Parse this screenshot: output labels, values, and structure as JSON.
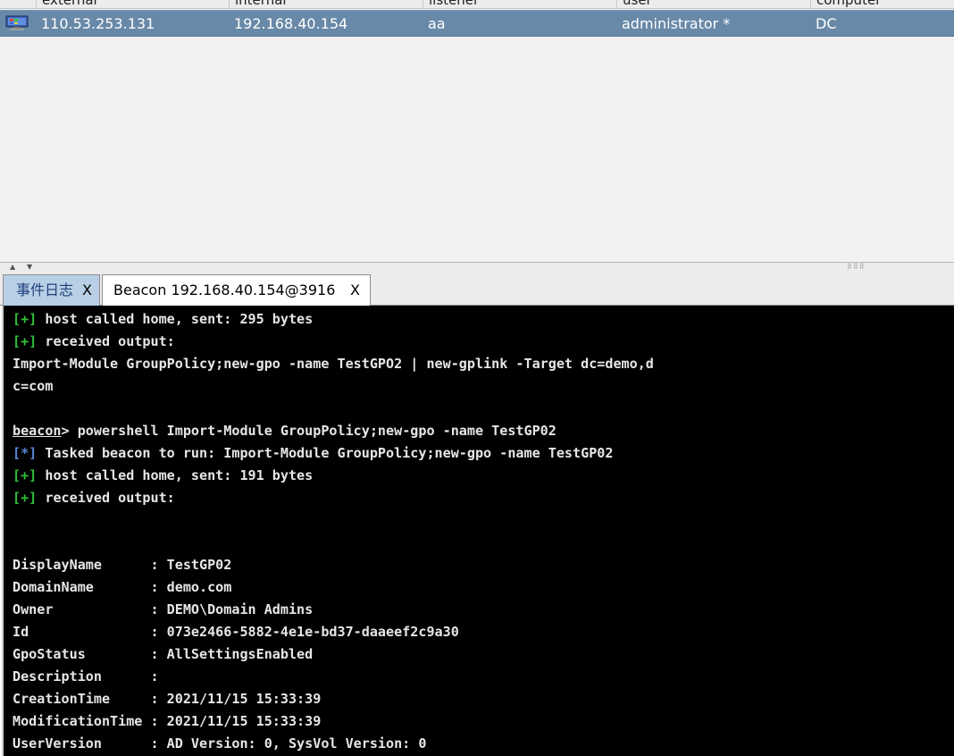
{
  "sessions_table": {
    "columns": [
      "external",
      "internal",
      "listener",
      "user",
      "computer"
    ],
    "rows": [
      {
        "icon": "windows-computer-icon",
        "external": "110.53.253.131",
        "internal": "192.168.40.154",
        "listener": "aa",
        "user": "administrator *",
        "computer": "DC"
      }
    ]
  },
  "splitter": {
    "up_arrow": "▲",
    "down_arrow": "▼",
    "grip": "⠿⠿⠿"
  },
  "tabs": [
    {
      "label": "事件日志",
      "close": "X"
    },
    {
      "label": "Beacon 192.168.40.154@3916",
      "close": "X"
    }
  ],
  "console": {
    "lines": [
      {
        "tag": "[+]",
        "text": " host called home, sent: 295 bytes"
      },
      {
        "tag": "[+]",
        "text": " received output:"
      },
      {
        "text": "Import-Module GroupPolicy;new-gpo -name TestGPO2 | new-gplink -Target dc=demo,d"
      },
      {
        "text": "c=com"
      },
      {
        "text": ""
      },
      {
        "prompt": "beacon",
        "text": "> powershell Import-Module GroupPolicy;new-gpo -name TestGP02"
      },
      {
        "tag": "[*]",
        "text": " Tasked beacon to run: Import-Module GroupPolicy;new-gpo -name TestGP02"
      },
      {
        "tag": "[+]",
        "text": " host called home, sent: 191 bytes"
      },
      {
        "tag": "[+]",
        "text": " received output:"
      },
      {
        "text": ""
      },
      {
        "text": ""
      },
      {
        "text": "DisplayName      : TestGP02"
      },
      {
        "text": "DomainName       : demo.com"
      },
      {
        "text": "Owner            : DEMO\\Domain Admins"
      },
      {
        "text": "Id               : 073e2466-5882-4e1e-bd37-daaeef2c9a30"
      },
      {
        "text": "GpoStatus        : AllSettingsEnabled"
      },
      {
        "text": "Description      :"
      },
      {
        "text": "CreationTime     : 2021/11/15 15:33:39"
      },
      {
        "text": "ModificationTime : 2021/11/15 15:33:39"
      },
      {
        "text": "UserVersion      : AD Version: 0, SysVol Version: 0"
      }
    ]
  },
  "colors": {
    "selected_row": "#6889a8",
    "console_bg": "#000000",
    "success_tag": "#2fbf3a",
    "info_tag": "#5a86d6"
  }
}
